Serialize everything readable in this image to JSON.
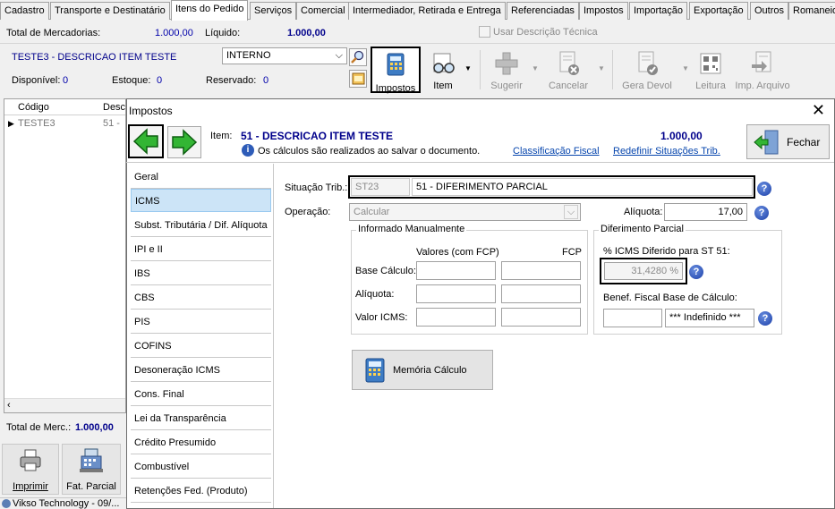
{
  "tabs": [
    "Cadastro",
    "Transporte e Destinatário",
    "Itens do Pedido",
    "Serviços",
    "Comercial",
    "Intermediador, Retirada e Entrega",
    "Referenciadas",
    "Impostos",
    "Importação",
    "Exportação",
    "Outros",
    "Romaneio"
  ],
  "header": {
    "total_merc_label": "Total de Mercadorias:",
    "total_merc_value": "1.000,00",
    "liquido_label": "Líquido:",
    "liquido_value": "1.000,00",
    "usar_desc_label": "Usar Descrição Técnica",
    "item_desc": "TESTE3 - DESCRICAO ITEM TESTE",
    "interno_value": "INTERNO",
    "disponivel_label": "Disponível:",
    "disponivel_value": "0",
    "estoque_label": "Estoque:",
    "estoque_value": "0",
    "reservado_label": "Reservado:",
    "reservado_value": "0"
  },
  "toolbar": {
    "impostos": "Impostos",
    "item": "Item",
    "sugerir": "Sugerir",
    "cancelar": "Cancelar",
    "gera_devol": "Gera Devol",
    "leitura": "Leitura",
    "imp_arquivo": "Imp. Arquivo"
  },
  "grid": {
    "col_codigo": "Código",
    "col_desc": "Desc",
    "row_codigo": "TESTE3",
    "row_desc": "51 -",
    "total_label": "Total de Merc.:",
    "total_value": "1.000,00"
  },
  "bottom": {
    "imprimir": "Imprimir",
    "fat_parcial": "Fat. Parcial",
    "status": "Vikso Technology - 09/..."
  },
  "dialog": {
    "title": "Impostos",
    "item_label": "Item:",
    "item_value": "51 - DESCRICAO ITEM TESTE",
    "item_total": "1.000,00",
    "info": "Os cálculos são realizados ao salvar o documento.",
    "classificacao": "Classificação Fiscal",
    "redefinir": "Redefinir Situações Trib.",
    "fechar": "Fechar",
    "sidebar": [
      "Geral",
      "ICMS",
      "Subst. Tributária / Dif. Alíquota",
      "IPI e II",
      "IBS",
      "CBS",
      "PIS",
      "COFINS",
      "Desoneração ICMS",
      "Cons. Final",
      "Lei da Transparência",
      "Crédito Presumido",
      "Combustível",
      "Retenções Fed. (Produto)"
    ],
    "situacao_label": "Situação Trib.:",
    "situacao_code": "ST23",
    "situacao_desc": "51 - DIFERIMENTO PARCIAL",
    "operacao_label": "Operação:",
    "operacao_value": "Calcular",
    "aliquota_label": "Alíquota:",
    "aliquota_value": "17,00",
    "manual_title": "Informado Manualmente",
    "valores_label": "Valores (com FCP)",
    "fcp_label": "FCP",
    "base_calc_label": "Base Cálculo:",
    "aliquota_row_label": "Alíquota:",
    "valor_icms_label": "Valor ICMS:",
    "dif_title": "Diferimento Parcial",
    "dif_label": "% ICMS Diferido para ST 51:",
    "dif_value": "31,4280 %",
    "benef_label": "Benef. Fiscal Base de Cálculo:",
    "benef_value": "*** Indefinido ***",
    "memoria": "Memória Cálculo"
  }
}
